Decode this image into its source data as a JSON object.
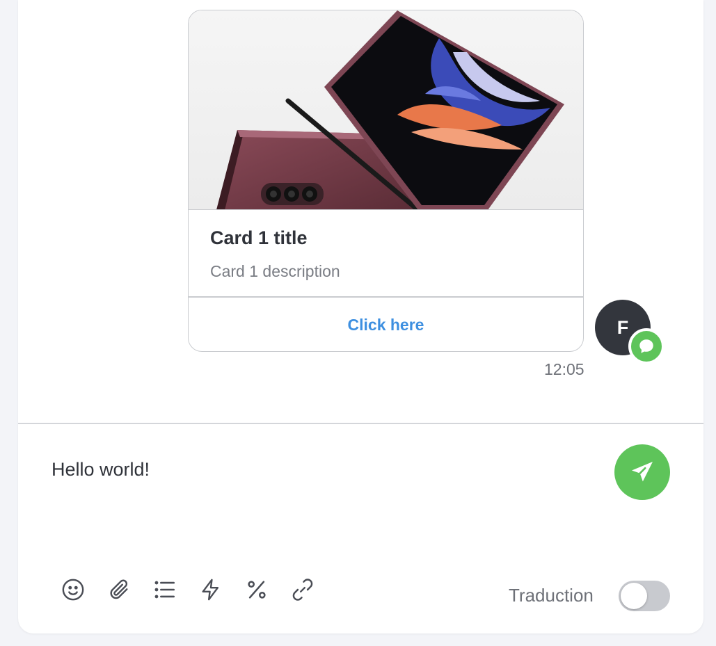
{
  "card": {
    "image": "foldable-phone-product-photo",
    "title": "Card 1 title",
    "description": "Card 1 description",
    "action_label": "Click here"
  },
  "message": {
    "avatar_initial": "F",
    "channel_icon": "chat-bubble-icon",
    "timestamp": "12:05"
  },
  "composer": {
    "text": "Hello world!",
    "send_icon": "paper-plane-icon",
    "tools": [
      "emoji-icon",
      "attachment-icon",
      "list-icon",
      "lightning-icon",
      "percent-icon",
      "link-icon"
    ],
    "translation_label": "Traduction",
    "translation_enabled": false
  },
  "colors": {
    "accent_green": "#5ec45a",
    "link_blue": "#3d8fe0",
    "avatar_dark": "#33363d"
  }
}
